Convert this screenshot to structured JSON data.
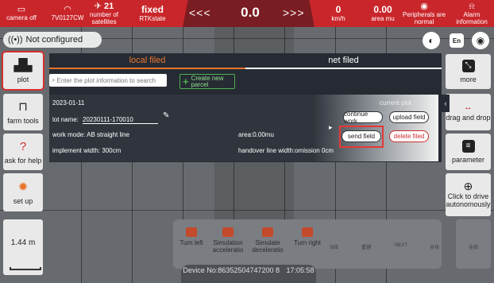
{
  "status_bar": {
    "camera": "camera off",
    "device_code": "7V0127CW",
    "satellites_count": "21",
    "satellites_label": "number of satellites",
    "rtk_value": "fixed",
    "rtk_label": "RTKstate",
    "left_arrows": "<<<",
    "deviation": "0.0",
    "right_arrows": ">>>",
    "speed_value": "0",
    "speed_unit": "km/h",
    "area_value": "0.00",
    "area_unit": "area mu",
    "peripherals": "Peripherals are normal",
    "alarm": "Alarm information"
  },
  "map": {
    "not_configured": "Not configured",
    "en_label": "En",
    "waypoint_label": "B"
  },
  "left_sidebar": {
    "plot": "plot",
    "farm_tools": "farm tools",
    "ask_for_help": "ask for help",
    "set_up": "set up",
    "scale": "1.44 m"
  },
  "right_sidebar": {
    "more": "more",
    "drag_and_drop": "drag and drop",
    "parameter": "parameter",
    "click_to_drive": "Click to drive autonomously"
  },
  "panel": {
    "tab_local": "local filed",
    "tab_net": "net filed",
    "search_placeholder": "Enter the plot information to search",
    "create_new": "Create new parcel",
    "card": {
      "date": "2023-01-11",
      "current_plot": "current plot",
      "lot_name_label": "lot name:",
      "lot_name_value": "20230111-170010",
      "work_mode": "work mode: AB straight line",
      "area": "area:0.00mu",
      "implement_width": "implement width: 300cm",
      "handover": "handover line width:omission 0cm",
      "continue_work": "continue work",
      "upload_field": "upload field",
      "send_field": "send field",
      "delete_field": "delete filed"
    }
  },
  "bottom_panel": {
    "turn_left": "Turn left",
    "sim_accel": "Simulation acceleratio",
    "sim_decel": "Simulate deceleratio",
    "turn_right": "Turn right",
    "small1": "B线",
    "small2": "重铺",
    "small3": "NEXT",
    "small4": "全块",
    "small5": "全线"
  },
  "device": {
    "number": "Device No:86352504747200 8",
    "time": "17:05:58"
  }
}
